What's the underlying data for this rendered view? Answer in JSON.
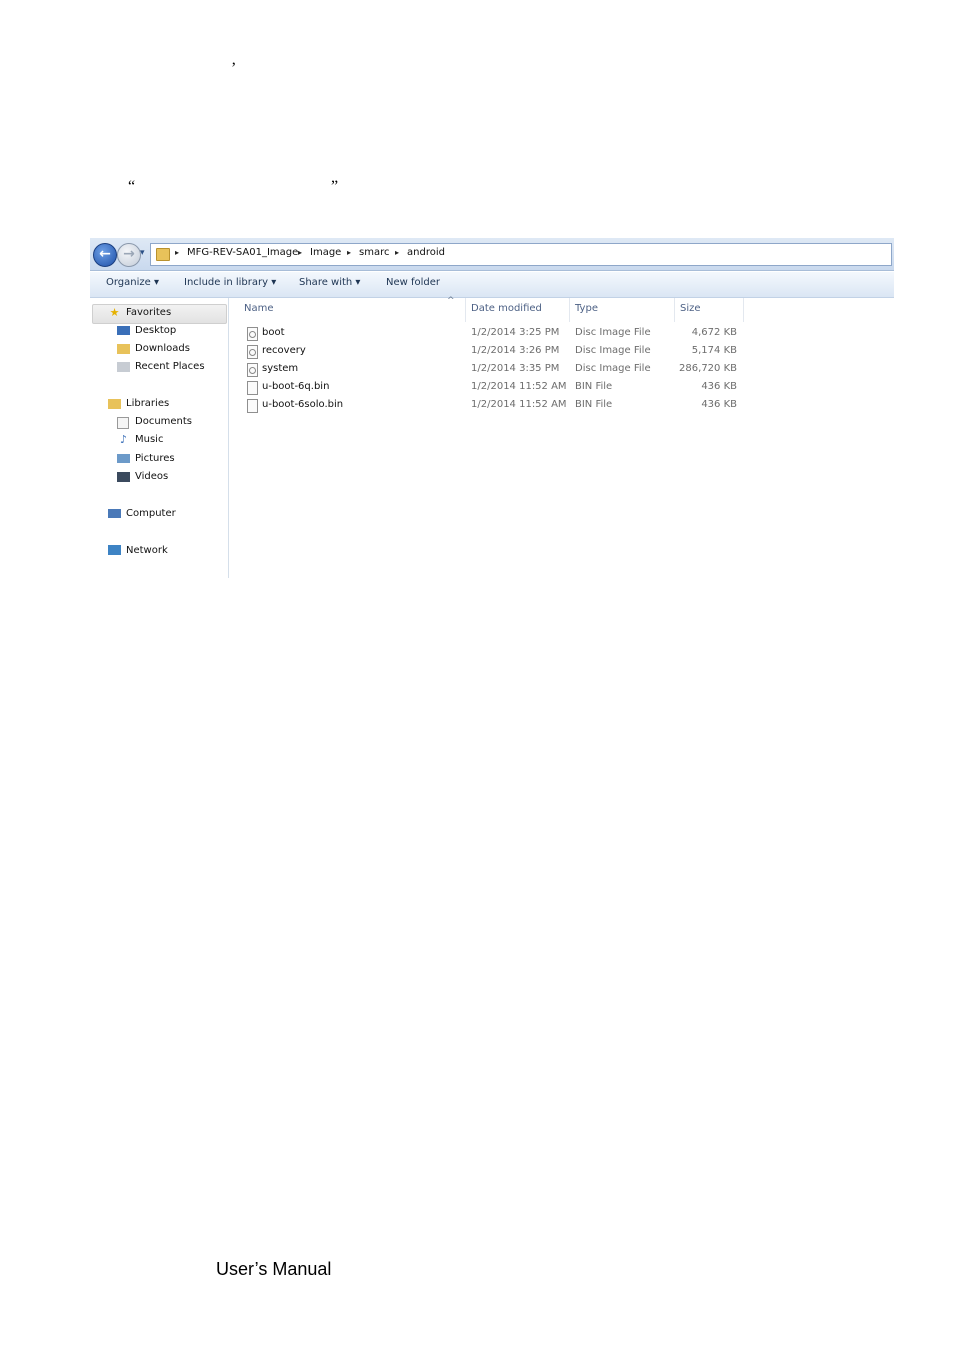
{
  "doc": {
    "apostrophe": "’",
    "open_quote": "“",
    "close_quote": "”",
    "footer": "User’s Manual"
  },
  "explorer": {
    "nav": {
      "back_glyph": "←",
      "fwd_glyph": "→",
      "dropdown_glyph": "▾"
    },
    "breadcrumb": [
      {
        "label": "MFG-REV-SA01_Image"
      },
      {
        "label": "Image"
      },
      {
        "label": "smarc"
      },
      {
        "label": "android"
      }
    ],
    "crumb_sep": "▸",
    "toolbar": {
      "organize": "Organize ▾",
      "include": "Include in library ▾",
      "share": "Share with ▾",
      "new_folder": "New folder"
    },
    "sidebar": {
      "favorites": "Favorites",
      "desktop": "Desktop",
      "downloads": "Downloads",
      "recent": "Recent Places",
      "libraries": "Libraries",
      "documents": "Documents",
      "music": "Music",
      "pictures": "Pictures",
      "videos": "Videos",
      "computer": "Computer",
      "network": "Network"
    },
    "columns": {
      "name": "Name",
      "date": "Date modified",
      "type": "Type",
      "size": "Size"
    },
    "sort_glyph": "^",
    "files": [
      {
        "name": "boot",
        "date": "1/2/2014 3:25 PM",
        "type": "Disc Image File",
        "size": "4,672 KB",
        "icon": "disc-image-icon"
      },
      {
        "name": "recovery",
        "date": "1/2/2014 3:26 PM",
        "type": "Disc Image File",
        "size": "5,174 KB",
        "icon": "disc-image-icon"
      },
      {
        "name": "system",
        "date": "1/2/2014 3:35 PM",
        "type": "Disc Image File",
        "size": "286,720 KB",
        "icon": "disc-image-icon"
      },
      {
        "name": "u-boot-6q.bin",
        "date": "1/2/2014 11:52 AM",
        "type": "BIN File",
        "size": "436 KB",
        "icon": "file-icon"
      },
      {
        "name": "u-boot-6solo.bin",
        "date": "1/2/2014 11:52 AM",
        "type": "BIN File",
        "size": "436 KB",
        "icon": "file-icon"
      }
    ]
  }
}
